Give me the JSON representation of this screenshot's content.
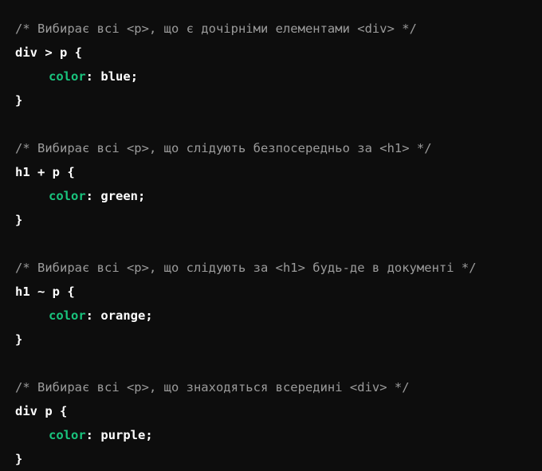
{
  "colors": {
    "background": "#0d0d0d",
    "comment": "#9b9b9b",
    "property": "#19c37d",
    "text": "#ffffff"
  },
  "rules": [
    {
      "comment": "/* Вибирає всі <p>, що є дочірніми елементами <div> */",
      "selector": "div > p",
      "open": "{",
      "property": "color",
      "colon": ":",
      "value": "blue",
      "semicolon": ";",
      "close": "}"
    },
    {
      "comment": "/* Вибирає всі <p>, що слідують безпосередньо за <h1> */",
      "selector": "h1 + p",
      "open": "{",
      "property": "color",
      "colon": ":",
      "value": "green",
      "semicolon": ";",
      "close": "}"
    },
    {
      "comment": "/* Вибирає всі <p>, що слідують за <h1> будь-де в документі */",
      "selector": "h1 ~ p",
      "open": "{",
      "property": "color",
      "colon": ":",
      "value": "orange",
      "semicolon": ";",
      "close": "}"
    },
    {
      "comment": "/* Вибирає всі <p>, що знаходяться всередині <div> */",
      "selector": "div p",
      "open": "{",
      "property": "color",
      "colon": ":",
      "value": "purple",
      "semicolon": ";",
      "close": "}"
    }
  ]
}
